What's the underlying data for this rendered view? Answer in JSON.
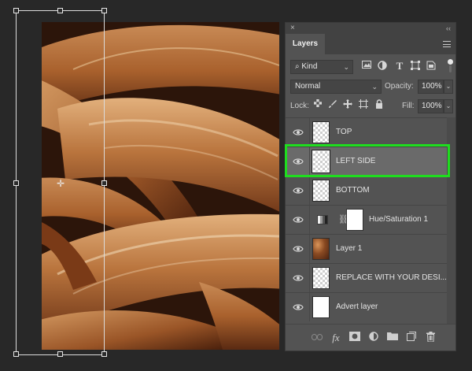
{
  "panel": {
    "close_glyph": "×",
    "collapse_glyph": "‹‹",
    "tab_label": "Layers",
    "filter": {
      "kind_label": "Kind",
      "search_glyph": "⌕",
      "chevron": "⌄",
      "icons": [
        "image-filter-icon",
        "adjustment-filter-icon",
        "type-filter-icon",
        "shape-filter-icon",
        "smart-object-filter-icon"
      ]
    },
    "blend": {
      "mode": "Normal",
      "opacity_label": "Opacity:",
      "opacity_value": "100%"
    },
    "lock": {
      "label": "Lock:",
      "fill_label": "Fill:",
      "fill_value": "100%"
    },
    "layers": [
      {
        "name": "TOP",
        "thumb": "transparent",
        "selected": false
      },
      {
        "name": "LEFT SIDE",
        "thumb": "transparent",
        "selected": true
      },
      {
        "name": "BOTTOM",
        "thumb": "transparent",
        "selected": false
      },
      {
        "name": "Hue/Saturation 1",
        "thumb": "adjustment",
        "selected": false
      },
      {
        "name": "Layer 1",
        "thumb": "photo",
        "selected": false
      },
      {
        "name": "REPLACE WITH YOUR DESI...",
        "thumb": "transparent",
        "selected": false
      },
      {
        "name": "Advert layer",
        "thumb": "white",
        "selected": false
      }
    ],
    "bottom_icons": {
      "link": "⊖",
      "fx": "fx",
      "mask": "◙",
      "adjustment": "◐",
      "group": "▬",
      "new": "⊡",
      "trash": "🗑"
    }
  },
  "colors": {
    "highlight": "#1fdd1f",
    "panel_bg": "#535353",
    "app_bg": "#282828"
  }
}
